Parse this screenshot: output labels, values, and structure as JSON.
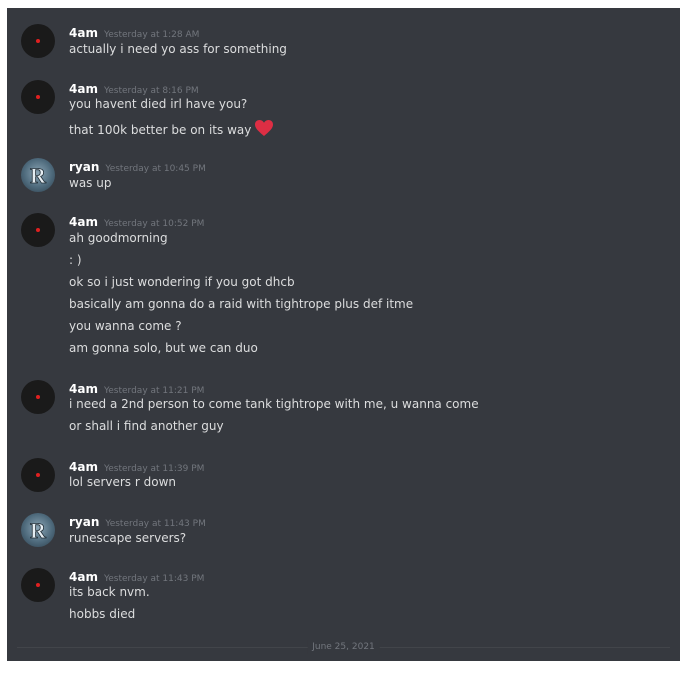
{
  "messages": [
    {
      "author": "4am",
      "avatar": "dark-red-dot-avatar",
      "timestamp": "Yesterday at 1:28 AM",
      "lines": [
        "actually i need yo ass for something"
      ]
    },
    {
      "author": "4am",
      "avatar": "dark-red-dot-avatar",
      "timestamp": "Yesterday at 8:16 PM",
      "lines": [
        "you havent died irl have you?",
        "that 100k better be on its way"
      ],
      "emoji": "red-heart-icon"
    },
    {
      "author": "ryan",
      "avatar": "runescape-r-logo-avatar",
      "timestamp": "Yesterday at 10:45 PM",
      "lines": [
        "was up"
      ]
    },
    {
      "author": "4am",
      "avatar": "dark-red-dot-avatar",
      "timestamp": "Yesterday at 10:52 PM",
      "lines": [
        "ah goodmorning",
        ": )",
        "ok so i just wondering if you got dhcb",
        "basically am gonna do a raid with tightrope plus def itme",
        "you wanna come ?",
        "am gonna solo, but we can duo"
      ]
    },
    {
      "author": "4am",
      "avatar": "dark-red-dot-avatar",
      "timestamp": "Yesterday at 11:21 PM",
      "lines": [
        "i need a 2nd person to come tank tightrope with me, u wanna come",
        "or shall i find another guy"
      ]
    },
    {
      "author": "4am",
      "avatar": "dark-red-dot-avatar",
      "timestamp": "Yesterday at 11:39 PM",
      "lines": [
        "lol servers r down"
      ]
    },
    {
      "author": "ryan",
      "avatar": "runescape-r-logo-avatar",
      "timestamp": "Yesterday at 11:43 PM",
      "lines": [
        "runescape servers?"
      ]
    },
    {
      "author": "4am",
      "avatar": "dark-red-dot-avatar",
      "timestamp": "Yesterday at 11:43 PM",
      "lines": [
        "its back nvm.",
        "hobbs died"
      ]
    }
  ],
  "date_divider": "June 25, 2021",
  "colors": {
    "background": "#36393f",
    "username": "#ffffff",
    "message_text": "#dcddde",
    "timestamp": "#72767d",
    "heart": "#dd2e44"
  }
}
